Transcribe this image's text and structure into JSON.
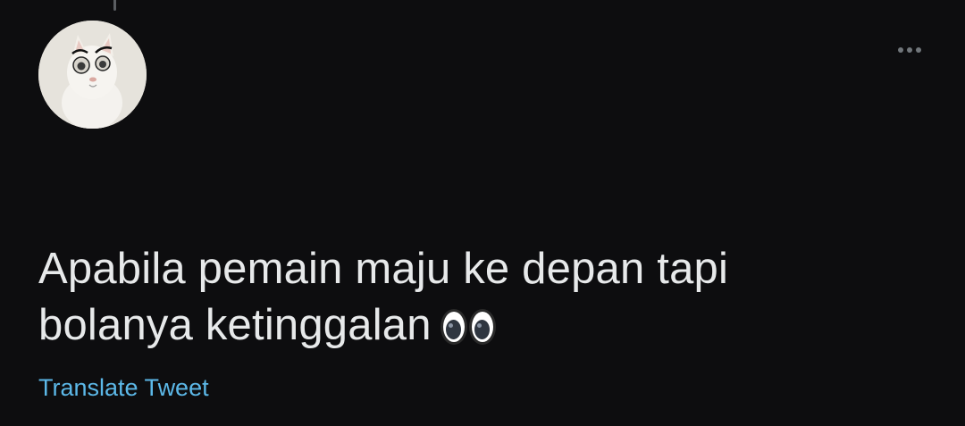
{
  "tweet": {
    "text": "Apabila pemain maju ke depan tapi\nbolanya ketinggalan",
    "emoji": "eyes-emoji",
    "translate_label": "Translate Tweet"
  },
  "avatar": {
    "icon": "cat-avatar"
  },
  "more": {
    "icon": "more-dots-icon"
  },
  "colors": {
    "background": "#0d0d0f",
    "text": "#e7e9ea",
    "link": "#5cb8e8",
    "muted": "#71767b"
  }
}
